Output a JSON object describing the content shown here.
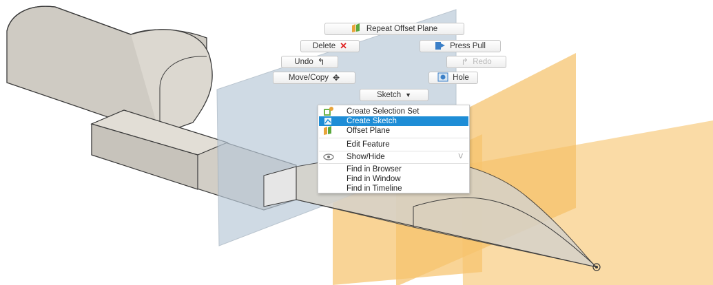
{
  "marking_menu": {
    "repeat_label": "Repeat Offset Plane",
    "delete_label": "Delete",
    "press_pull_label": "Press Pull",
    "undo_label": "Undo",
    "redo_label": "Redo",
    "move_copy_label": "Move/Copy",
    "hole_label": "Hole",
    "sketch_label": "Sketch"
  },
  "context_menu": {
    "items": [
      {
        "label": "Create Selection Set",
        "icon": "selection-set-icon"
      },
      {
        "label": "Create Sketch",
        "icon": "sketch-icon",
        "highlighted": true
      },
      {
        "label": "Offset Plane",
        "icon": "offset-plane-icon"
      },
      {
        "label": "Edit Feature"
      },
      {
        "label": "Show/Hide",
        "icon": "eye-icon",
        "shortcut": "V"
      },
      {
        "label": "Find in Browser"
      },
      {
        "label": "Find in Window"
      },
      {
        "label": "Find in Timeline"
      }
    ]
  },
  "colors": {
    "highlight": "#1e8dd6",
    "plane_orange": "#f7c46e",
    "plane_blue": "#b7c8d9",
    "body_gray": "#d6d3cc"
  }
}
